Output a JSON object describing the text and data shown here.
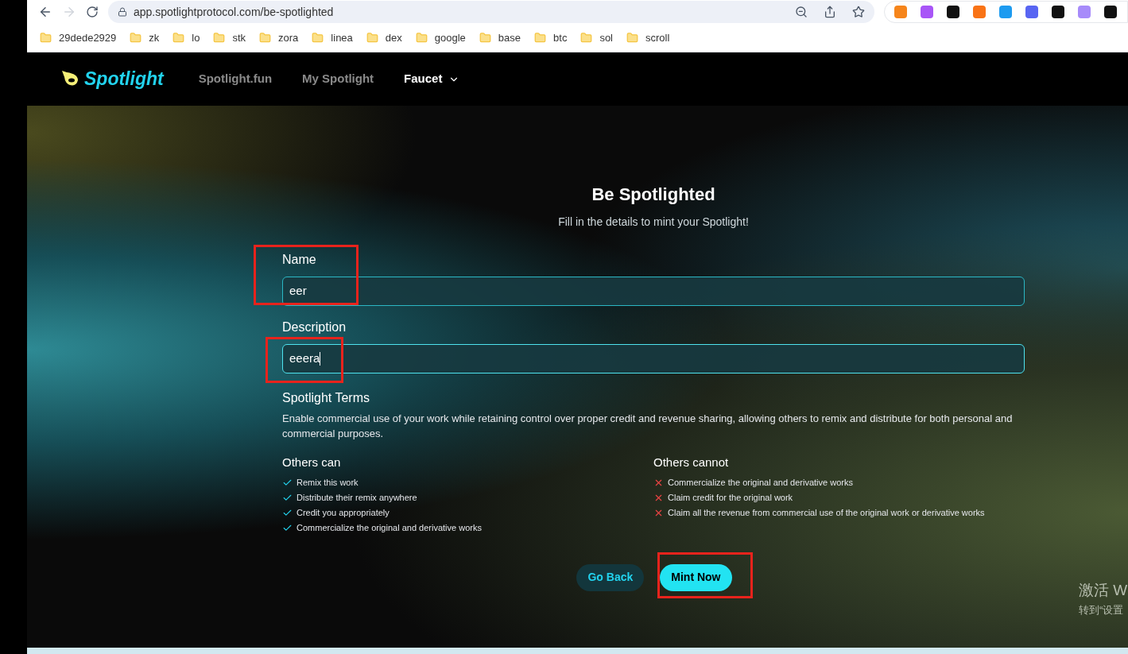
{
  "browser": {
    "url": "app.spotlightprotocol.com/be-spotlighted",
    "bookmarks": [
      "29dede2929",
      "zk",
      "lo",
      "stk",
      "zora",
      "linea",
      "dex",
      "google",
      "base",
      "btc",
      "sol",
      "scroll"
    ]
  },
  "nav": {
    "logo": "Spotlight",
    "links": [
      {
        "label": "Spotlight.fun",
        "selected": false,
        "dropdown": false
      },
      {
        "label": "My Spotlight",
        "selected": false,
        "dropdown": false
      },
      {
        "label": "Faucet",
        "selected": true,
        "dropdown": true
      }
    ]
  },
  "form": {
    "title": "Be Spotlighted",
    "subtitle": "Fill in the details to mint your Spotlight!",
    "fields": [
      {
        "label": "Name",
        "value": "eer",
        "focused": false,
        "highlighted": true
      },
      {
        "label": "Description",
        "value": "eeera",
        "focused": true,
        "highlighted": true
      }
    ],
    "terms": {
      "title": "Spotlight Terms",
      "text": "Enable commercial use of your work while retaining control over proper credit and revenue sharing, allowing others to remix and distribute for both personal and commercial purposes.",
      "columns": [
        {
          "title": "Others can",
          "kind": "allowed",
          "items": [
            "Remix this work",
            "Distribute their remix anywhere",
            "Credit you appropriately",
            "Commercialize the original and derivative works"
          ]
        },
        {
          "title": "Others cannot",
          "kind": "denied",
          "items": [
            "Commercialize the original and derivative works",
            "Claim credit for the original work",
            "Claim all the revenue from commercial use of the original work or derivative works"
          ]
        }
      ]
    },
    "buttons": [
      {
        "label": "Go Back",
        "kind": "secondary",
        "highlighted": false
      },
      {
        "label": "Mint Now",
        "kind": "primary",
        "highlighted": true
      }
    ]
  },
  "system_notice": [
    "激活 W",
    "转到“设置"
  ]
}
